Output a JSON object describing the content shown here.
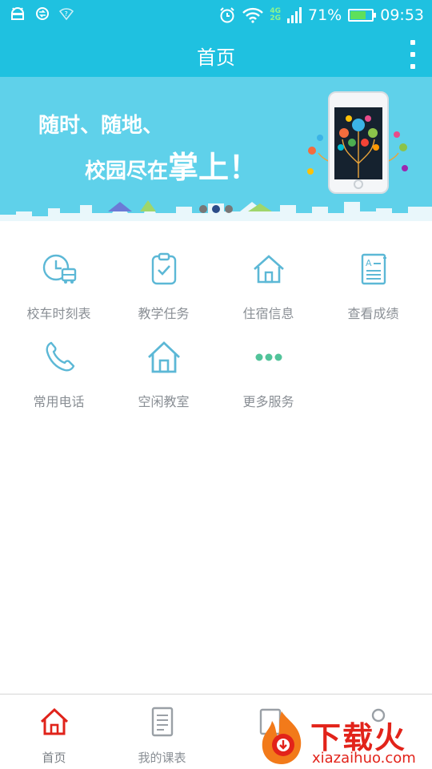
{
  "status_bar": {
    "network_top": "4G",
    "network_bottom": "2G",
    "battery_percent_text": "71%",
    "battery_level": 0.71,
    "time": "09:53"
  },
  "header": {
    "title": "首页"
  },
  "banner": {
    "line1": "随时、随地、",
    "line2_prefix": "校园尽在",
    "line2_emphasis": "掌上！",
    "pager": {
      "total": 3,
      "active": 1
    }
  },
  "services": [
    {
      "label": "校车时刻表",
      "icon": "bus-clock-icon"
    },
    {
      "label": "教学任务",
      "icon": "clipboard-check-icon"
    },
    {
      "label": "住宿信息",
      "icon": "house-outline-icon"
    },
    {
      "label": "查看成绩",
      "icon": "grade-report-icon"
    },
    {
      "label": "常用电话",
      "icon": "phone-icon"
    },
    {
      "label": "空闲教室",
      "icon": "house-icon"
    },
    {
      "label": "更多服务",
      "icon": "more-dots-icon"
    }
  ],
  "bottom_nav": [
    {
      "label": "首页",
      "icon": "home-icon",
      "active": true
    },
    {
      "label": "我的课表",
      "icon": "schedule-icon",
      "active": false
    }
  ],
  "watermark": {
    "brand": "下载火",
    "domain": "xiazaihuo.com"
  },
  "colors": {
    "primary": "#1fc1e0",
    "banner": "#5fd1ea",
    "icon_blue": "#5cb8d6",
    "icon_green": "#52c39a",
    "active_red": "#e0231b",
    "text_gray": "#8a8f95"
  }
}
